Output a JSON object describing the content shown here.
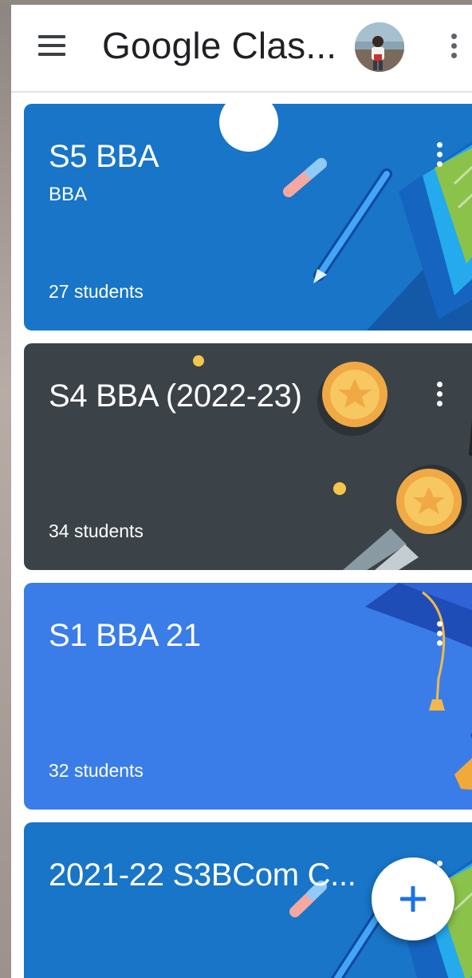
{
  "app_bar": {
    "title": "Google Clas...",
    "menu_icon": "hamburger-menu-icon",
    "avatar_icon": "profile-avatar",
    "more_icon": "more-vert-icon"
  },
  "classes": [
    {
      "title": "S5 BBA",
      "subtitle": "BBA",
      "students": "27 students",
      "theme": "blue-pencil",
      "color": "#1875c8"
    },
    {
      "title": "S4 BBA (2022-23)",
      "subtitle": "",
      "students": "34 students",
      "theme": "dark-medal",
      "color": "#3b4348"
    },
    {
      "title": "S1 BBA 21",
      "subtitle": "",
      "students": "32 students",
      "theme": "blue-graduation",
      "color": "#3a7de8"
    },
    {
      "title": "2021-22 S3BCom C...",
      "subtitle": "",
      "students": "",
      "theme": "blue-pencil",
      "color": "#1875c8"
    }
  ],
  "fab": {
    "icon": "plus-icon",
    "color": "#1a73e8"
  }
}
